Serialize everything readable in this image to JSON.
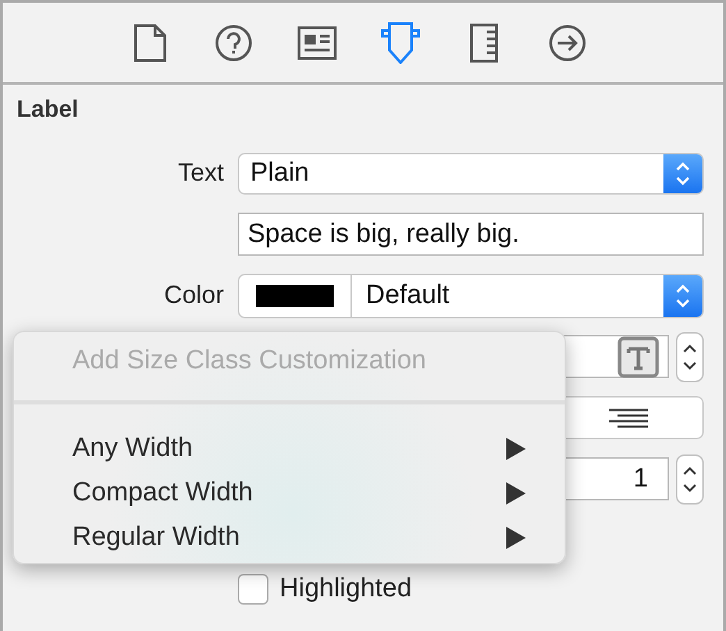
{
  "toolbar": {
    "tools": [
      {
        "kind": "file",
        "selected": false
      },
      {
        "kind": "help",
        "selected": false
      },
      {
        "kind": "identity",
        "selected": false
      },
      {
        "kind": "attributes",
        "selected": true
      },
      {
        "kind": "size",
        "selected": false
      },
      {
        "kind": "connections",
        "selected": false
      }
    ]
  },
  "section": {
    "title": "Label"
  },
  "text": {
    "label": "Text",
    "value": "Plain",
    "content": "Space is big, really big."
  },
  "color": {
    "label": "Color",
    "value": "Default"
  },
  "lines": {
    "value": "1"
  },
  "checkboxes": [
    {
      "label": "Highlighted",
      "checked": false
    }
  ],
  "menu": {
    "title": "Add Size Class Customization",
    "items": [
      {
        "label": "Any Width"
      },
      {
        "label": "Compact Width"
      },
      {
        "label": "Regular Width"
      }
    ]
  }
}
